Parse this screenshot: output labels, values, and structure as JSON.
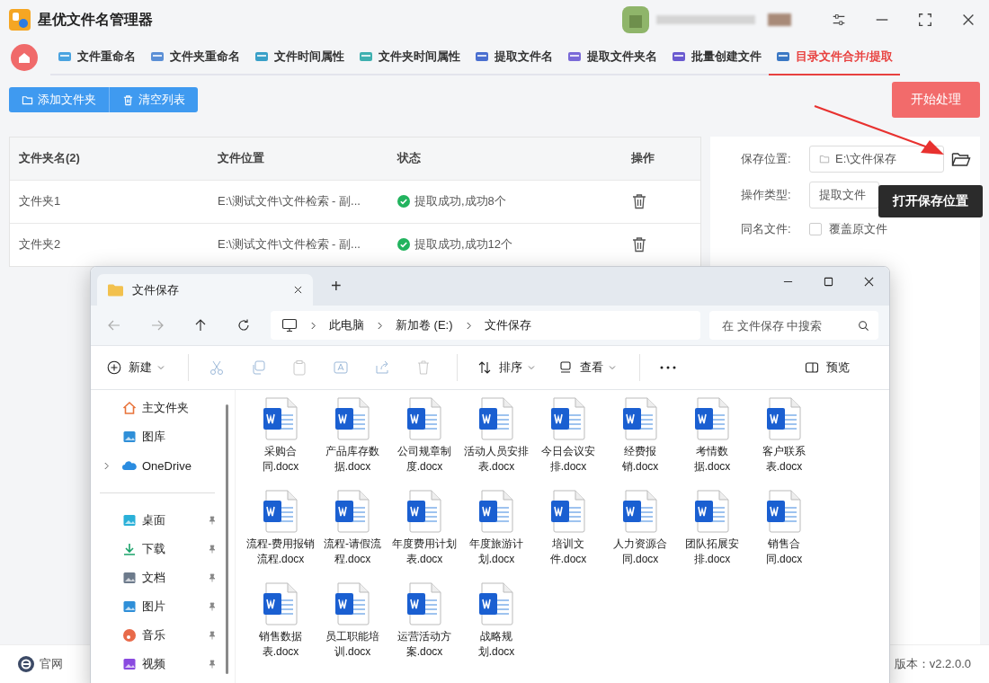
{
  "app": {
    "title": "星优文件名管理器",
    "tabs": [
      {
        "label": "文件重命名",
        "selected": false
      },
      {
        "label": "文件夹重命名",
        "selected": false
      },
      {
        "label": "文件时间属性",
        "selected": false
      },
      {
        "label": "文件夹时间属性",
        "selected": false
      },
      {
        "label": "提取文件名",
        "selected": false
      },
      {
        "label": "提取文件夹名",
        "selected": false
      },
      {
        "label": "批量创建文件",
        "selected": false
      },
      {
        "label": "目录文件合并/提取",
        "selected": true
      }
    ],
    "toolbar": [
      {
        "label": "添加文件夹",
        "kind": "add"
      },
      {
        "label": "清空列表",
        "kind": "clear"
      }
    ],
    "start_button": "开始处理",
    "table": {
      "columns": [
        "文件夹名(2)",
        "文件位置",
        "状态",
        "操作"
      ],
      "rows": [
        {
          "name": "文件夹1",
          "location": "E:\\测试文件\\文件检索 - 副...",
          "status": "提取成功,成功8个"
        },
        {
          "name": "文件夹2",
          "location": "E:\\测试文件\\文件检索 - 副...",
          "status": "提取成功,成功12个"
        }
      ]
    },
    "settings": {
      "save_location": {
        "label": "保存位置:",
        "value": "E:\\文件保存"
      },
      "operation_type": {
        "label": "操作类型:",
        "value": "提取文件"
      },
      "same_name": {
        "label": "同名文件:",
        "option": "覆盖原文件",
        "checked": false
      }
    },
    "tooltip": "打开保存位置",
    "footer": {
      "website": "官网",
      "version": "版本：v2.2.0.0"
    }
  },
  "explorer": {
    "tab_title": "文件保存",
    "new_tab": "+",
    "breadcrumb": [
      "此电脑",
      "新加卷 (E:)",
      "文件保存"
    ],
    "search": {
      "placeholder": "在 文件保存 中搜索"
    },
    "commands": [
      {
        "label": "新建",
        "kind": "new"
      },
      {
        "label": "排序",
        "kind": "sort"
      },
      {
        "label": "查看",
        "kind": "view"
      },
      {
        "label": "预览",
        "kind": "preview"
      }
    ],
    "nav": [
      {
        "label": "主文件夹",
        "pinned": false,
        "expandable": false
      },
      {
        "label": "图库",
        "pinned": false,
        "expandable": false
      },
      {
        "label": "OneDrive",
        "pinned": false,
        "expandable": true
      },
      {
        "label": "桌面",
        "pinned": true,
        "expandable": false
      },
      {
        "label": "下载",
        "pinned": true,
        "expandable": false
      },
      {
        "label": "文档",
        "pinned": true,
        "expandable": false
      },
      {
        "label": "图片",
        "pinned": true,
        "expandable": false
      },
      {
        "label": "音乐",
        "pinned": true,
        "expandable": false
      },
      {
        "label": "视频",
        "pinned": true,
        "expandable": false
      }
    ],
    "files": [
      {
        "name": "采购合同.docx"
      },
      {
        "name": "产品库存数据.docx"
      },
      {
        "name": "公司规章制度.docx"
      },
      {
        "name": "活动人员安排表.docx"
      },
      {
        "name": "今日会议安排.docx"
      },
      {
        "name": "经费报销.docx"
      },
      {
        "name": "考情数据.docx"
      },
      {
        "name": "客户联系表.docx"
      },
      {
        "name": "流程-费用报销流程.docx"
      },
      {
        "name": "流程-请假流程.docx"
      },
      {
        "name": "年度费用计划表.docx"
      },
      {
        "name": "年度旅游计划.docx"
      },
      {
        "name": "培训文件.docx"
      },
      {
        "name": "人力资源合同.docx"
      },
      {
        "name": "团队拓展安排.docx"
      },
      {
        "name": "销售合同.docx"
      },
      {
        "name": "销售数据表.docx"
      },
      {
        "name": "员工职能培训.docx"
      },
      {
        "name": "运营活动方案.docx"
      },
      {
        "name": "战略规划.docx"
      }
    ]
  }
}
